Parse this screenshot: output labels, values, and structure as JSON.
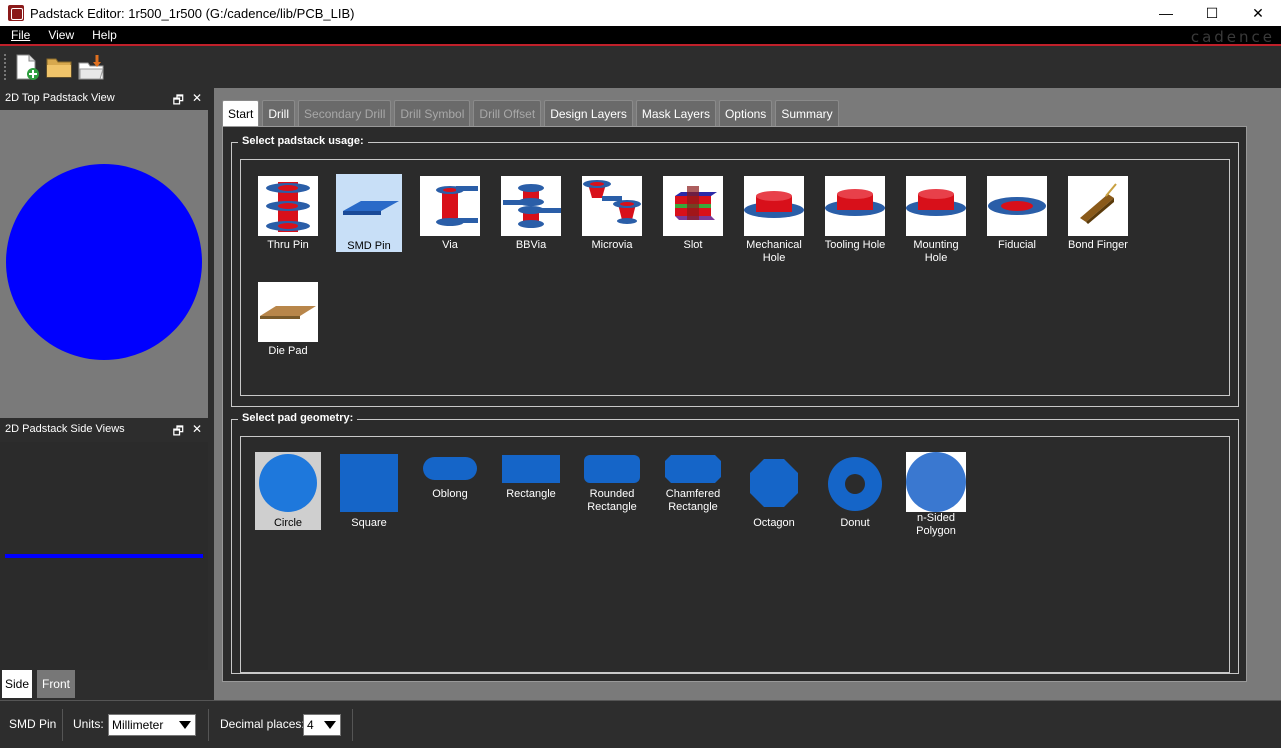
{
  "window": {
    "title": "Padstack Editor: 1r500_1r500  (G:/cadence/lib/PCB_LIB)",
    "minimize": "—",
    "maximize": "☐",
    "close": "✕"
  },
  "menu": {
    "file": "File",
    "view": "View",
    "help": "Help",
    "brand": "cadence"
  },
  "panels": {
    "top_view_title": "2D Top Padstack View",
    "side_view_title": "2D Padstack Side Views",
    "float_glyph": "🗗",
    "close_glyph": "✕",
    "side_tabs": [
      "Side",
      "Front"
    ]
  },
  "tabs": [
    "Start",
    "Drill",
    "Secondary Drill",
    "Drill Symbol",
    "Drill Offset",
    "Design Layers",
    "Mask Layers",
    "Options",
    "Summary"
  ],
  "usage": {
    "label": "Select padstack usage:",
    "items": [
      "Thru Pin",
      "SMD Pin",
      "Via",
      "BBVia",
      "Microvia",
      "Slot",
      "Mechanical Hole",
      "Tooling Hole",
      "Mounting Hole",
      "Fiducial",
      "Bond Finger",
      "Die Pad"
    ],
    "selected": "SMD Pin"
  },
  "geometry": {
    "label": "Select pad geometry:",
    "items": [
      "Circle",
      "Square",
      "Oblong",
      "Rectangle",
      "Rounded Rectangle",
      "Chamfered Rectangle",
      "Octagon",
      "Donut",
      "n-Sided Polygon"
    ],
    "selected": "Circle"
  },
  "status": {
    "usage": "SMD Pin",
    "units_label": "Units:",
    "units_value": "Millimeter",
    "decimal_label": "Decimal places:",
    "decimal_value": "4"
  },
  "colors": {
    "pad_blue": "#0000ff",
    "geo_blue": "#1565c0",
    "selection": "#c8dff7",
    "accent_red": "#c0202a"
  }
}
